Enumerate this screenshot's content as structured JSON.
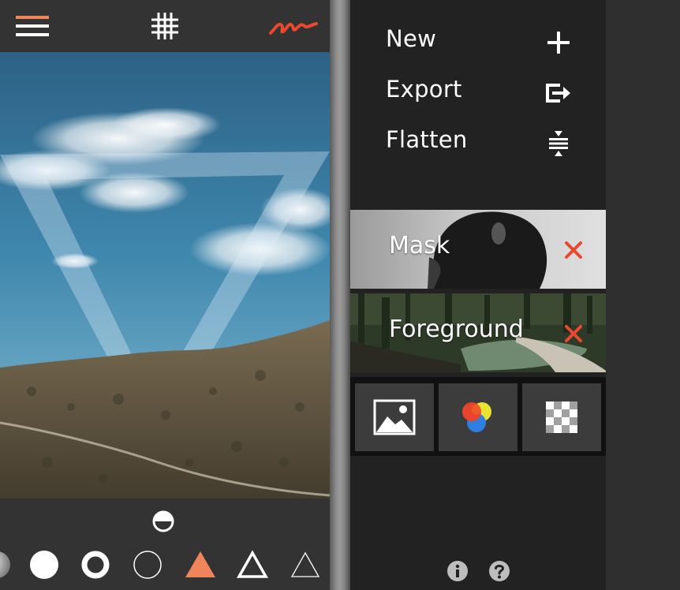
{
  "menu": {
    "new_label": "New",
    "export_label": "Export",
    "flatten_label": "Flatten"
  },
  "layers": [
    {
      "label": "Mask"
    },
    {
      "label": "Foreground"
    }
  ],
  "icons": {
    "toolbar": [
      "hamburger-menu-icon",
      "grid-icon",
      "signature-icon"
    ],
    "shapes": [
      "sphere-shape-icon",
      "filled-circle-icon",
      "ring-icon",
      "outline-circle-icon",
      "filled-triangle-icon",
      "outline-triangle-icon",
      "thin-triangle-icon"
    ],
    "tools": [
      "image-icon",
      "color-blend-icon",
      "checkerboard-icon"
    ],
    "footer": [
      "info-icon",
      "help-icon"
    ]
  },
  "colors": {
    "accent": "#f0845a",
    "delete": "#e9492c",
    "panel": "#333333",
    "menu_bg": "#222222"
  }
}
